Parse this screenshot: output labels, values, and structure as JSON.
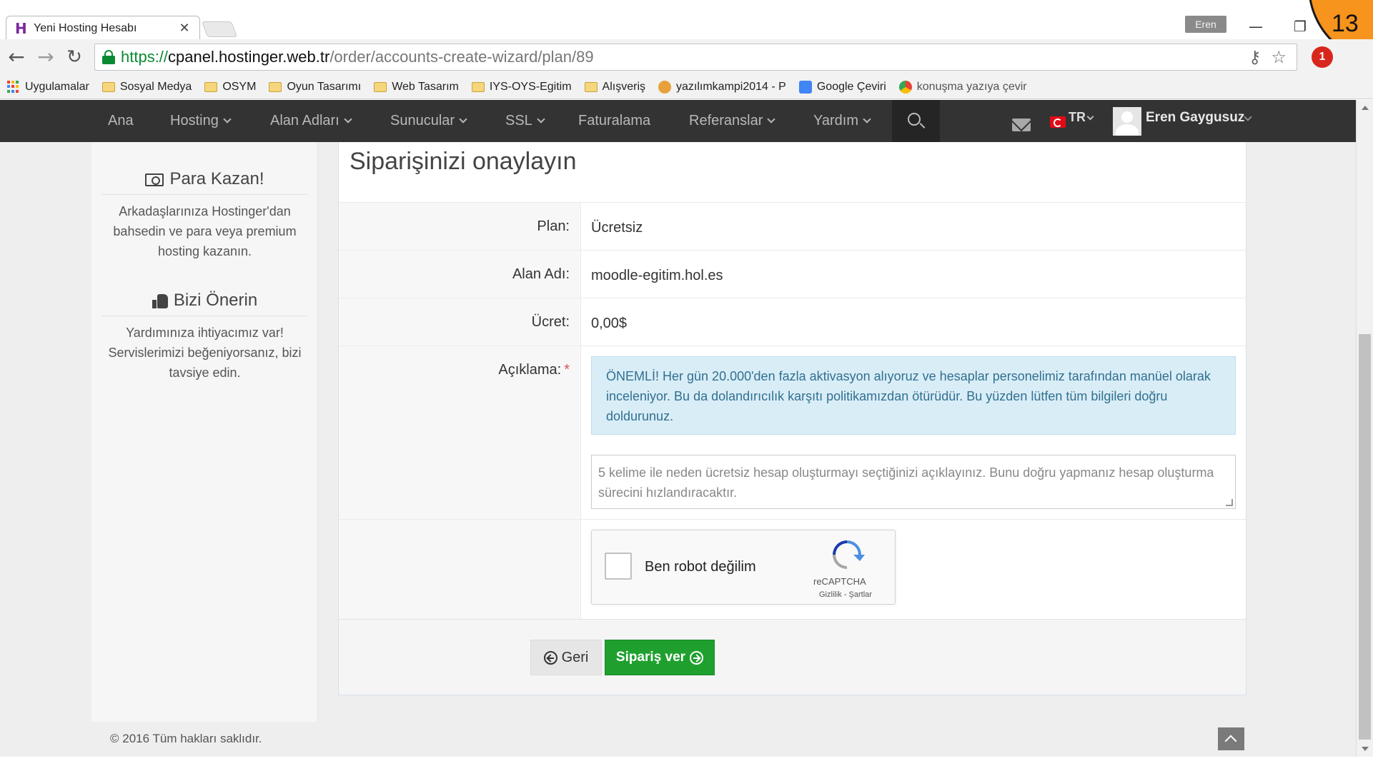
{
  "browser": {
    "tab_title": "Yeni Hosting Hesabı",
    "tab_close": "✕",
    "profile_name": "Eren",
    "window_controls": [
      "—",
      "❐",
      "✕"
    ],
    "slide_number": "13",
    "url_secure_part": "https://",
    "url_host": "cpanel.hostinger.web.tr",
    "url_path": "/order/accounts-create-wizard/plan/89",
    "ext_badge": "1",
    "icons": [
      "back-arrow-icon",
      "forward-arrow-icon",
      "reload-icon",
      "lock-icon",
      "key-icon",
      "star-icon"
    ]
  },
  "bookmarks": [
    {
      "label": "Uygulamalar",
      "icon": "apps-icon"
    },
    {
      "label": "Sosyal Medya",
      "icon": "folder-icon"
    },
    {
      "label": "OSYM",
      "icon": "folder-icon"
    },
    {
      "label": "Oyun Tasarımı",
      "icon": "folder-icon"
    },
    {
      "label": "Web Tasarım",
      "icon": "folder-icon"
    },
    {
      "label": "IYS-OYS-Egitim",
      "icon": "folder-icon"
    },
    {
      "label": "Alışveriş",
      "icon": "folder-icon"
    },
    {
      "label": "yazılımkampi2014 - P",
      "icon": "tiger-icon"
    },
    {
      "label": "Google Çeviri",
      "icon": "translate-icon"
    },
    {
      "label": "konuşma yazıya çevir",
      "icon": "chrome-icon"
    }
  ],
  "nav": {
    "items": [
      {
        "label": "Ana",
        "dropdown": false
      },
      {
        "label": "Hosting",
        "dropdown": true
      },
      {
        "label": "Alan Adları",
        "dropdown": true
      },
      {
        "label": "Sunucular",
        "dropdown": true
      },
      {
        "label": "SSL",
        "dropdown": true
      },
      {
        "label": "Faturalama",
        "dropdown": false
      },
      {
        "label": "Referanslar",
        "dropdown": true
      },
      {
        "label": "Yardım",
        "dropdown": true
      }
    ],
    "language": "TR",
    "user_name": "Eren Gaygusuz"
  },
  "sidebar": {
    "earn_title": "Para Kazan!",
    "earn_text": "Arkadaşlarınıza Hostinger'dan bahsedin ve para veya premium hosting kazanın.",
    "recommend_title": "Bizi Önerin",
    "recommend_text": "Yardımınıza ihtiyacımız var! Servislerimizi beğeniyorsanız, bizi tavsiye edin."
  },
  "order": {
    "title": "Siparişinizi onaylayın",
    "plan_label": "Plan:",
    "plan_value": "Ücretsiz",
    "domain_label": "Alan Adı:",
    "domain_value": "moodle-egitim.hol.es",
    "price_label": "Ücret:",
    "price_value": "0,00$",
    "description_label": "Açıklama:",
    "required_mark": "*",
    "notice": "ÖNEMLİ! Her gün 20.000'den fazla aktivasyon alıyoruz ve hesaplar personelimiz tarafından manüel olarak inceleniyor. Bu da dolandırıcılık karşıtı politikamızdan ötürüdür. Bu yüzden lütfen tüm bilgileri doğru doldurunuz.",
    "description_placeholder": "5 kelime ile neden ücretsiz hesap oluşturmayı seçtiğinizi açıklayınız. Bunu doğru yapmanız hesap oluşturma sürecini hızlandıracaktır.",
    "captcha_label": "Ben robot değilim",
    "captcha_brand": "reCAPTCHA",
    "captcha_terms": "Gizlilik - Şartlar",
    "back_button": "Geri",
    "submit_button": "Sipariş ver"
  },
  "footer": {
    "copyright": "© 2016 Tüm hakları saklıdır."
  },
  "colors": {
    "nav_bg": "#333333",
    "primary_button": "#1fa02e",
    "notice_bg": "#d9edf7",
    "notice_text": "#31708f",
    "secure_url": "#0b8a33",
    "accent_badge": "#f7941d"
  }
}
